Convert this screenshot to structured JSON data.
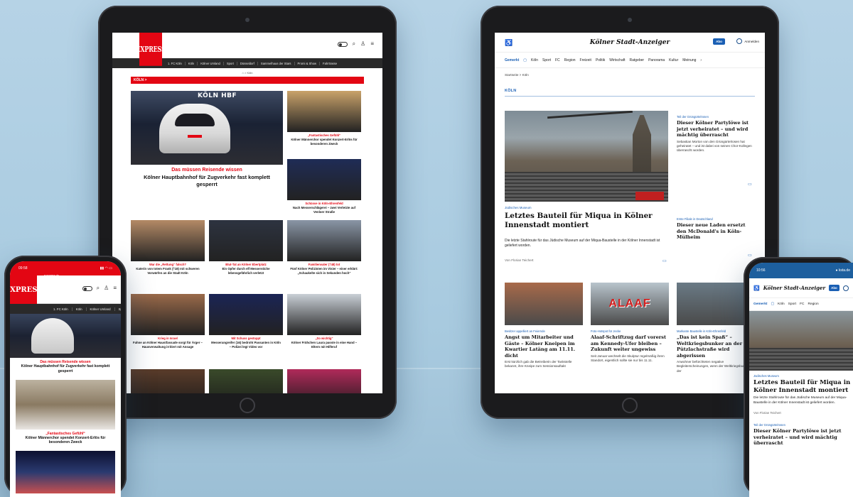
{
  "express": {
    "logo": "EXPRESS",
    "nav": [
      "1. FC Köln",
      "Köln",
      "Kölner Umland",
      "Sport",
      "Düsseldorf",
      "Sammelhaus der Stars",
      "Promi & Show",
      "Fahrtrasse"
    ],
    "breadcrumb": "⌂ > Köln",
    "section": "KÖLN >",
    "hero": {
      "image_sign": "KÖLN HBF",
      "kicker": "Das müssen Reisende wissen",
      "title": "Kölner Hauptbahnhof für Zugverkehr fast komplett gesperrt"
    },
    "cards": [
      {
        "kicker": "„Fantastisches Gefühl“",
        "title": "Kölner Männerchor spendet Konzert-Erlös für besonderen Zweck",
        "color": "#c9a26a"
      },
      {
        "kicker": "Schüsse in Köln-Ehrenfeld",
        "title": "Nach Messerschlägerei – zwei Verletzte auf Venloer Straße",
        "color": "#1f2c56"
      },
      {
        "kicker": "War die „Rettung“ falsch?",
        "title": "Katerin von totem Frank (†18) mit schweren Vorwürfen an die Stadt Köln",
        "color": "#b48a66"
      },
      {
        "kicker": "Blut-Tat an Kölner Ebertplatz",
        "title": "Ein Opfer durch elf Messerstiche lebensgefährlich verletzt",
        "color": "#2d3340"
      },
      {
        "kicker": "Familienvater (†48) tot",
        "title": "Fünf Kölner Polizisten im Visier – einer erklärt: „Schaukelte sich in Sekunden hoch“",
        "color": "#8a96a6"
      },
      {
        "kicker": "Krieg in Israel",
        "title": "Fahne an Kölner Haustfassade sorgt für Ärger – Hausverwaltung irritiert mit Ansage",
        "color": "#9a6a4a"
      },
      {
        "kicker": "Mit Schuss gestoppt",
        "title": "Messerangreifer (16) bedroht Passanten in Köln – Polizei legt Video vor",
        "color": "#1b2455"
      },
      {
        "kicker": "„So wichtig“",
        "title": "Kölner Frühchen Laura passte in eine Hand – Eltern mit Hilferuf",
        "color": "#c9cfd6"
      }
    ],
    "bottom_row_colors": [
      "#5a3c2a",
      "#3a4a2a",
      "#b02a5a"
    ]
  },
  "ksta": {
    "brand": "Kölner Stadt-Anzeiger",
    "abo_label": "Abo",
    "login_label": "Anmelden",
    "nav": [
      "Gemerkt",
      "Köln",
      "Sport",
      "FC",
      "Region",
      "Freizeit",
      "Politik",
      "Wirtschaft",
      "Ratgeber",
      "Panorama",
      "Kultur",
      "Meinung",
      "›"
    ],
    "breadcrumb": "Startseite  >  Köln",
    "section": "KÖLN",
    "hero": {
      "kicker": "Jüdisches Museum",
      "title": "Letztes Bauteil für Miqua in Kölner Innenstadt montiert",
      "teaser": "Die letzte Stahlroute für das Jüdische Museum auf der Miqua-Baustelle in der Kölner Innenstadt ist geliefert worden.",
      "author": "Von Florian Teichert"
    },
    "side": [
      {
        "kicker": "Teil der Grüngürtelrosen",
        "title": "Dieser Kölner Partylöwe ist jetzt verheiratet – und wird mächtig überrascht",
        "teaser": "Sebastian Morton von den Grüngürtelrosen hat geheiratet – und ist dabei von seinen Chor-Kollegen überrascht worden."
      },
      {
        "kicker": "Erste Filiale in Deutschland",
        "title": "Dieser neue Laden ersetzt den McDonald's in Köln-Mülheim",
        "teaser": ""
      }
    ],
    "row": [
      {
        "kicker": "Besitzer appelliert an Feiernde",
        "title": "Angst um Mitarbeiter und Gäste – Kölner Kneipen im Kwartier Latäng am 11.11. dicht",
        "teaser": "Erst kürzlich gab die Betreiberin der Tankstelle bekannt, ihre Kneipe zum Sessionsauftakt",
        "color": "#a86a4a"
      },
      {
        "kicker": "Foto-Hotspot für Jecke",
        "title": "Alaaf-Schriftzug darf vorerst am Kennedy-Ufer bleiben – Zukunft weiter ungewiss",
        "teaser": "Seit Januar wechselt die Skulptur regelmäßig ihren Standort, eigentlich sollte sie nur bis 11.11.",
        "color": "#b8c4cc",
        "overlay": "ALAAF"
      },
      {
        "kicker": "Markante Baustelle in Köln-Ehrenfeld",
        "title": "„Das ist kein Spaß“ – Weltkriegsbunker an der Pützlachstraße wird abgerissen",
        "teaser": "Anwohner befürchteten negative Begleiterscheinungen, wenn der Weltkriegsbunker an der",
        "color": "#6a7a86"
      }
    ]
  },
  "phone_left": {
    "time": "09:58",
    "url": "● express.de",
    "logo": "EXPRESS",
    "nav": [
      "1. FC Köln",
      "Köln",
      "Kölner Umland",
      "Sp"
    ],
    "hero_kicker": "Das müssen Reisende wissen",
    "hero_title": "Kölner Hauptbahnhof für Zugverkehr fast komplett gesperrt",
    "card_kicker": "„Fantastisches Gefühl“",
    "card_title": "Kölner Männerchor spendet Konzert-Erlös für besonderen Zweck"
  },
  "phone_right": {
    "time": "10:56",
    "url": "● ksta.de",
    "brand": "Kölner Stadt-Anzeiger",
    "abo_label": "Abo",
    "nav": [
      "Gemerkt",
      "Köln",
      "Sport",
      "FC",
      "Region"
    ],
    "kicker": "Jüdisches Museum",
    "title": "Letztes Bauteil für Miqua in Kölner Innenstadt montiert",
    "teaser": "Die letzte Stahlroute für das Jüdische Museum auf der Miqua-Baustelle in der Kölner Innenstadt ist geliefert worden.",
    "author": "Von Florian Teichert",
    "kicker2": "Teil der Grüngürtelrosen",
    "title2": "Dieser Kölner Partylöwe ist jetzt verheiratet – und wird mächtig überrascht"
  }
}
